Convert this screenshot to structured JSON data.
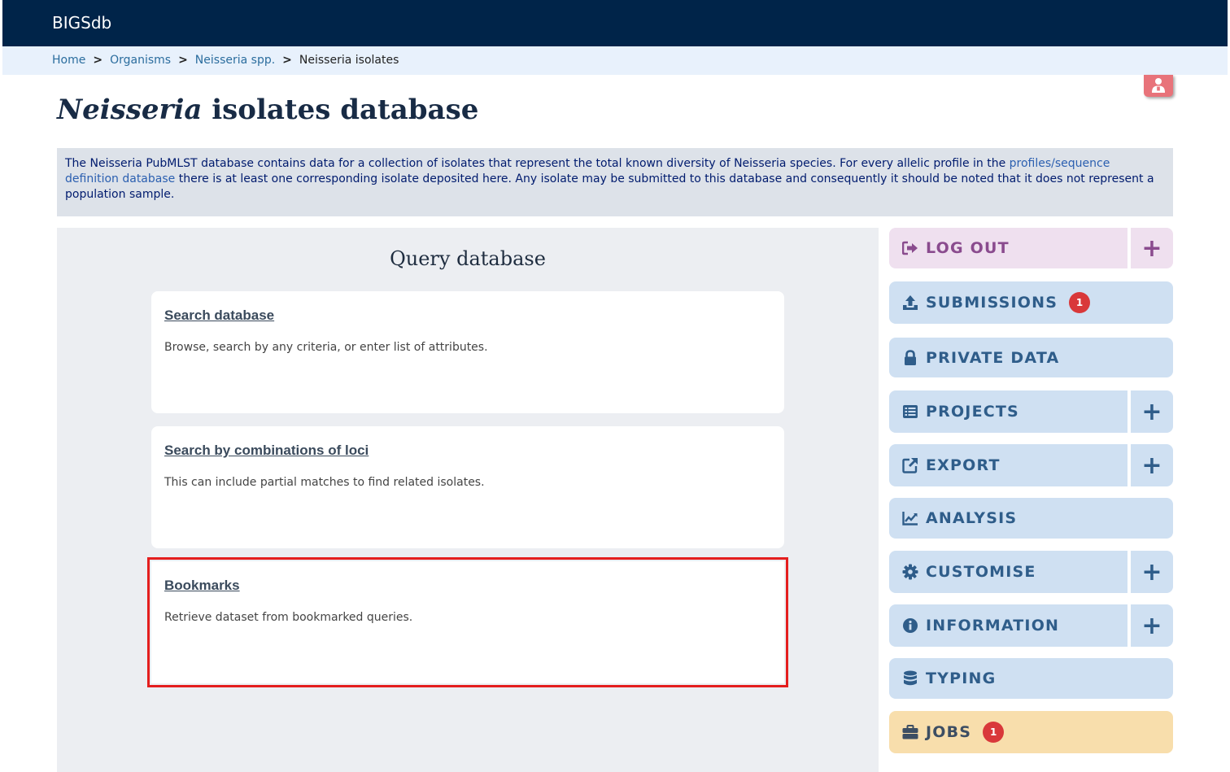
{
  "brand": "BIGSdb",
  "breadcrumb": {
    "items": [
      "Home",
      "Organisms",
      "Neisseria spp."
    ],
    "separator": ">",
    "current": "Neisseria isolates"
  },
  "title": {
    "italic": "Neisseria",
    "rest": " isolates database"
  },
  "banner": {
    "part1": "The Neisseria PubMLST database contains data for a collection of isolates that represent the total known diversity of Neisseria species. For every allelic profile in the ",
    "link": "profiles/sequence definition database",
    "part2": " there is at least one corresponding isolate deposited here. Any isolate may be submitted to this database and consequently it should be noted that it does not represent a population sample."
  },
  "query": {
    "heading": "Query database",
    "cards": [
      {
        "title": "Search database",
        "desc": "Browse, search by any criteria, or enter list of attributes."
      },
      {
        "title": "Search by combinations of loci",
        "desc": "This can include partial matches to find related isolates."
      },
      {
        "title": "Bookmarks",
        "desc": "Retrieve dataset from bookmarked queries."
      }
    ]
  },
  "menu": {
    "plus": "+",
    "items": [
      {
        "label": "LOG OUT",
        "icon": "sign-out-icon"
      },
      {
        "label": "SUBMISSIONS",
        "icon": "upload-icon",
        "badge": "1"
      },
      {
        "label": "PRIVATE DATA",
        "icon": "lock-icon"
      },
      {
        "label": "PROJECTS",
        "icon": "list-icon"
      },
      {
        "label": "EXPORT",
        "icon": "external-link-icon"
      },
      {
        "label": "ANALYSIS",
        "icon": "line-chart-icon"
      },
      {
        "label": "CUSTOMISE",
        "icon": "gear-icon"
      },
      {
        "label": "INFORMATION",
        "icon": "info-icon"
      },
      {
        "label": "TYPING",
        "icon": "database-icon"
      },
      {
        "label": "JOBS",
        "icon": "briefcase-icon",
        "badge": "1"
      }
    ]
  },
  "colors": {
    "topbar": "#002449",
    "menu_blue": "#cfe0f2",
    "logout_bg": "#efe0ef",
    "jobs_bg": "#f8deac",
    "highlight": "#e41e1e"
  }
}
